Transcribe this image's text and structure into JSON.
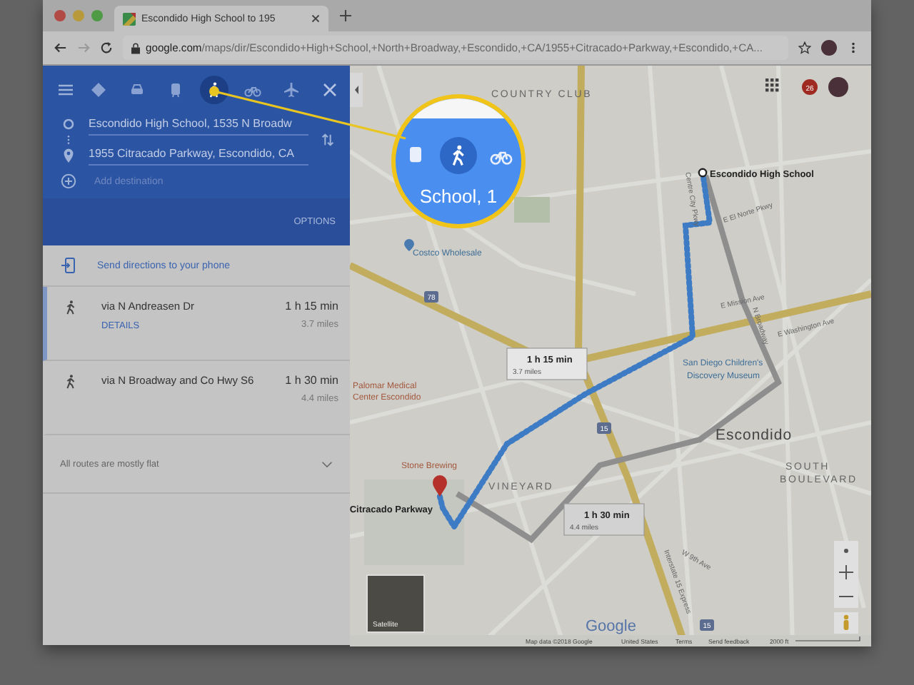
{
  "browser": {
    "tabs": [
      {
        "title": "Escondido High School to 195",
        "selected": true
      }
    ],
    "url_host": "google.com",
    "url_path": "/maps/dir/Escondido+High+School,+North+Broadway,+Escondido,+CA/1955+Citracado+Parkway,+Escondido,+CA..."
  },
  "panel": {
    "modes": [
      {
        "kind": "best",
        "selected": false
      },
      {
        "kind": "car",
        "selected": false
      },
      {
        "kind": "transit",
        "selected": false
      },
      {
        "kind": "walk",
        "selected": true
      },
      {
        "kind": "bike",
        "selected": false
      },
      {
        "kind": "flight",
        "selected": false
      }
    ],
    "from": "Escondido High School, 1535 N Broadw",
    "to": "1955 Citracado Parkway, Escondido, CA",
    "add_placeholder": "Add destination",
    "options": "OPTIONS",
    "send_phone": "Send directions to your phone",
    "routes": [
      {
        "via": "via N Andreasen Dr",
        "time": "1 h 15 min",
        "distance": "3.7 miles",
        "details": "DETAILS",
        "selected": true
      },
      {
        "via": "via N Broadway and Co Hwy S6",
        "time": "1 h 30 min",
        "distance": "4.4 miles",
        "selected": false
      }
    ],
    "note": "All routes are mostly flat"
  },
  "map": {
    "notification_count": "26",
    "origin": "Escondido High School",
    "destination": "Citracado Parkway",
    "places": [
      "COUNTRY CLUB",
      "Costco Wholesale",
      "San Diego Children's",
      "Discovery Museum",
      "Palomar Medical",
      "Center Escondido",
      "Stone Brewing",
      "VINEYARD",
      "Escondido",
      "SOUTH",
      "BOULEVARD"
    ],
    "streets": [
      "E Washington Ave",
      "N Broadway",
      "E El Norte Pkwy",
      "Interstate 15 Express",
      "W 9th Ave",
      "Centre City Pkwy",
      "E Mission Ave"
    ],
    "shields": [
      "78",
      "15",
      "15"
    ],
    "callouts": [
      {
        "time": "1 h 15 min",
        "distance": "3.7 miles",
        "selected": true
      },
      {
        "time": "1 h 30 min",
        "distance": "4.4 miles",
        "selected": false
      }
    ],
    "satellite": "Satellite",
    "logo": "Google",
    "footer": [
      "Map data ©2018 Google",
      "United States",
      "Terms",
      "Send feedback"
    ],
    "scale": "2000 ft"
  },
  "magnifier": {
    "text": "School, 1"
  }
}
